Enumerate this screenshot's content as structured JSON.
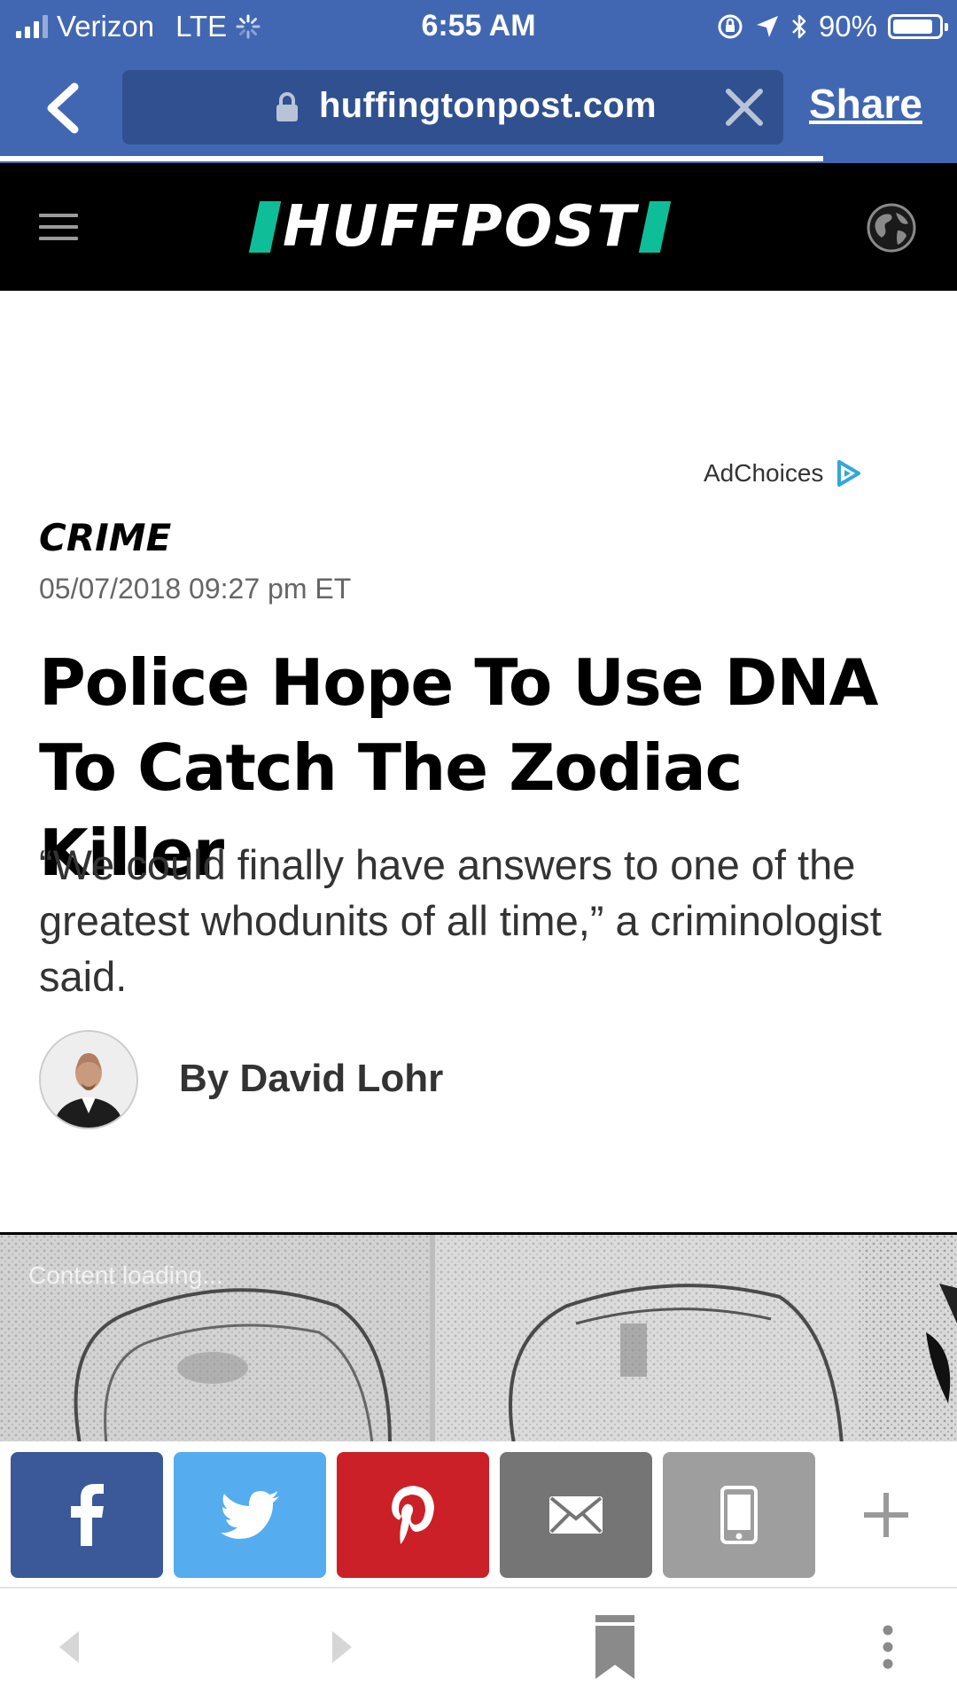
{
  "status_bar": {
    "carrier": "Verizon",
    "network": "LTE",
    "time": "6:55 AM",
    "battery": "90%",
    "battery_level": 0.9
  },
  "browser": {
    "url": "huffingtonpost.com",
    "share_label": "Share",
    "load_progress": 0.86
  },
  "site": {
    "logo": "HUFFPOST"
  },
  "ad": {
    "label": "AdChoices"
  },
  "article": {
    "section": "CRIME",
    "timestamp": "05/07/2018 09:27 pm ET",
    "headline": "Police Hope To Use DNA To Catch The Zodiac Killer",
    "dek": "“We could finally have answers to one of the greatest whodunits of all time,” a criminologist said.",
    "byline": "By David Lohr"
  },
  "media": {
    "loading_text": "Content loading..."
  },
  "colors": {
    "browser_chrome": "#4267b2",
    "huffpost_green": "#0dbe98",
    "facebook": "#3b5998",
    "twitter": "#55acee",
    "pinterest": "#cb2027",
    "email": "#757575",
    "sms": "#9e9e9e"
  },
  "icons": {
    "share_buttons": [
      "facebook-icon",
      "twitter-icon",
      "pinterest-icon",
      "email-icon",
      "phone-icon",
      "plus-icon"
    ],
    "bottom_bar": [
      "back-arrow-icon",
      "forward-arrow-icon",
      "bookmark-icon",
      "more-vertical-icon"
    ]
  }
}
